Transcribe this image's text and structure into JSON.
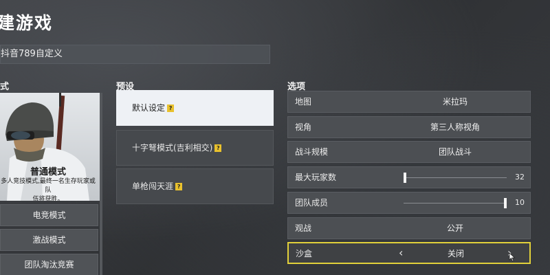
{
  "header": {
    "title": "建游戏",
    "room_name": "抖音789自定义"
  },
  "sections": {
    "mode": "式",
    "preset": "预设",
    "options": "选项"
  },
  "mode_card": {
    "title": "普通模式",
    "desc_line1": "多人竞技模式,最终一名生存玩家或队",
    "desc_line2": "伍将获胜。"
  },
  "modes": [
    "电竞模式",
    "激战模式",
    "团队淘汰竞赛"
  ],
  "presets": [
    {
      "label": "默认设定",
      "help": "?",
      "selected": true
    },
    {
      "label": "十字弩模式(吉利相交)",
      "help": "?",
      "selected": false
    },
    {
      "label": "单枪闯天涯",
      "help": "?",
      "selected": false
    }
  ],
  "options": {
    "map": {
      "label": "地图",
      "value": "米拉玛"
    },
    "perspective": {
      "label": "视角",
      "value": "第三人称视角"
    },
    "battle_size": {
      "label": "战斗规模",
      "value": "团队战斗"
    },
    "max_players": {
      "label": "最大玩家数",
      "value": "32",
      "slider_fraction": 0.0
    },
    "team_members": {
      "label": "团队成员",
      "value": "10",
      "slider_fraction": 1.0
    },
    "spectate": {
      "label": "观战",
      "value": "公开"
    },
    "sandbox": {
      "label": "沙盒",
      "value": "关闭",
      "prev": "‹",
      "next": "›"
    }
  },
  "colors": {
    "accent_highlight": "#e2d13a",
    "help_badge": "#e9c12d",
    "selected_preset_bg": "#eef1f5"
  }
}
